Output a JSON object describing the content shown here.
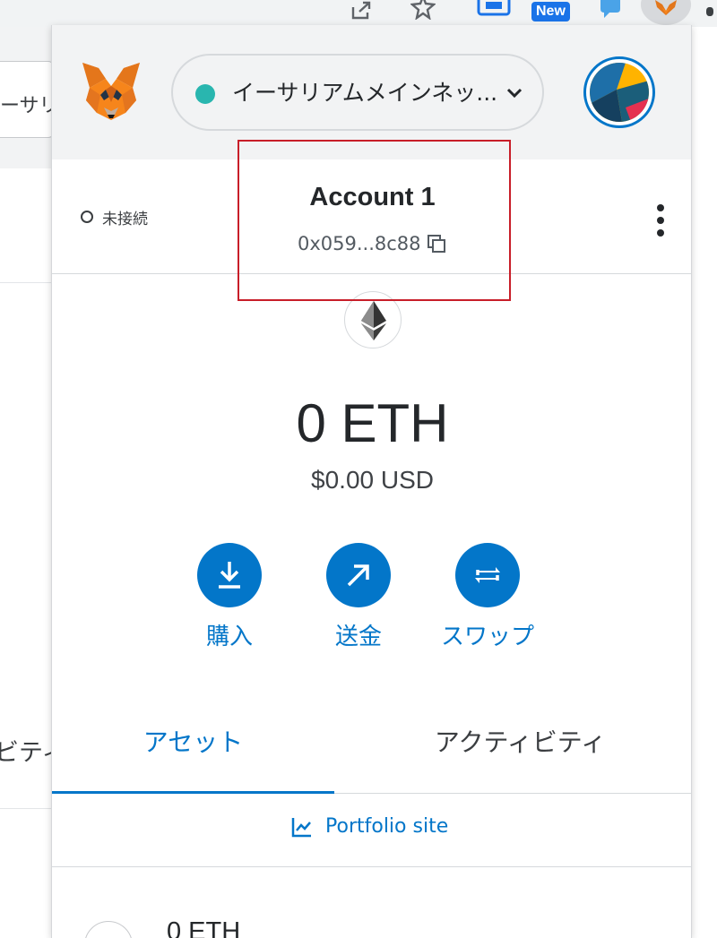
{
  "browser": {
    "new_badge": "New",
    "bg_network_text": "ーサリ",
    "bg_activity_text": "ビティ"
  },
  "header": {
    "network_name": "イーサリアムメインネッ...",
    "network_color": "#29b6af"
  },
  "account": {
    "connection_status": "未接続",
    "name": "Account 1",
    "address": "0x059...8c88"
  },
  "balance": {
    "eth": "0 ETH",
    "usd": "$0.00 USD"
  },
  "actions": {
    "buy": "購入",
    "send": "送金",
    "swap": "スワップ"
  },
  "tabs": {
    "assets": "アセット",
    "activity": "アクティビティ",
    "active": "assets"
  },
  "portfolio": {
    "label": "Portfolio site"
  },
  "assets": [
    {
      "name": "0 ETH"
    }
  ],
  "colors": {
    "accent": "#0376c9",
    "highlight": "#c81e29"
  }
}
